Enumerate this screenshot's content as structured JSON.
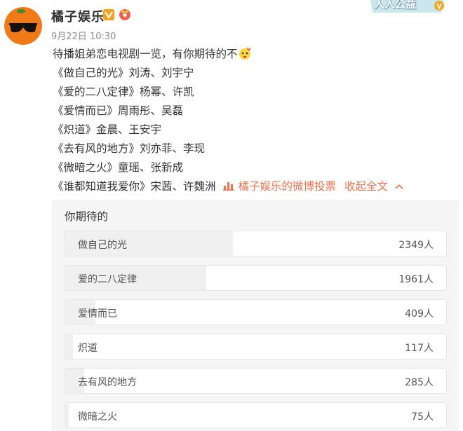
{
  "author": {
    "name": "橘子娱乐",
    "verified_icon": "v-verified-icon",
    "member_icon": "member-badge-icon",
    "time": "9月22日 10:30"
  },
  "banner": {
    "text": "人人公益"
  },
  "post": {
    "lines": [
      "待播姐弟恋电视剧一览，有你期待的不",
      "《做自己的光》刘涛、刘宇宁",
      "《爱的二八定律》杨幂、许凯",
      "《爱情而已》周雨彤、吴磊",
      "《炽道》金晨、王安宇",
      "《去有风的地方》刘亦菲、李现",
      "《微暗之火》童瑶、张新成"
    ],
    "last_line": "《谁都知道我爱你》宋茜、许魏洲",
    "poll_link": "橘子娱乐的微博投票",
    "collapse_link": "收起全文"
  },
  "poll": {
    "title": "你期待的",
    "options": [
      {
        "label": "做自己的光",
        "count": "2349人",
        "fraction": 0.44
      },
      {
        "label": "爱的二八定律",
        "count": "1961人",
        "fraction": 0.37
      },
      {
        "label": "爱情而已",
        "count": "409人",
        "fraction": 0.08
      },
      {
        "label": "炽道",
        "count": "117人",
        "fraction": 0.02
      },
      {
        "label": "去有风的地方",
        "count": "285人",
        "fraction": 0.05
      },
      {
        "label": "微暗之火",
        "count": "75人",
        "fraction": 0.01
      }
    ]
  },
  "colors": {
    "link": "#eb7350",
    "poll_bg": "#f5f5f5"
  }
}
